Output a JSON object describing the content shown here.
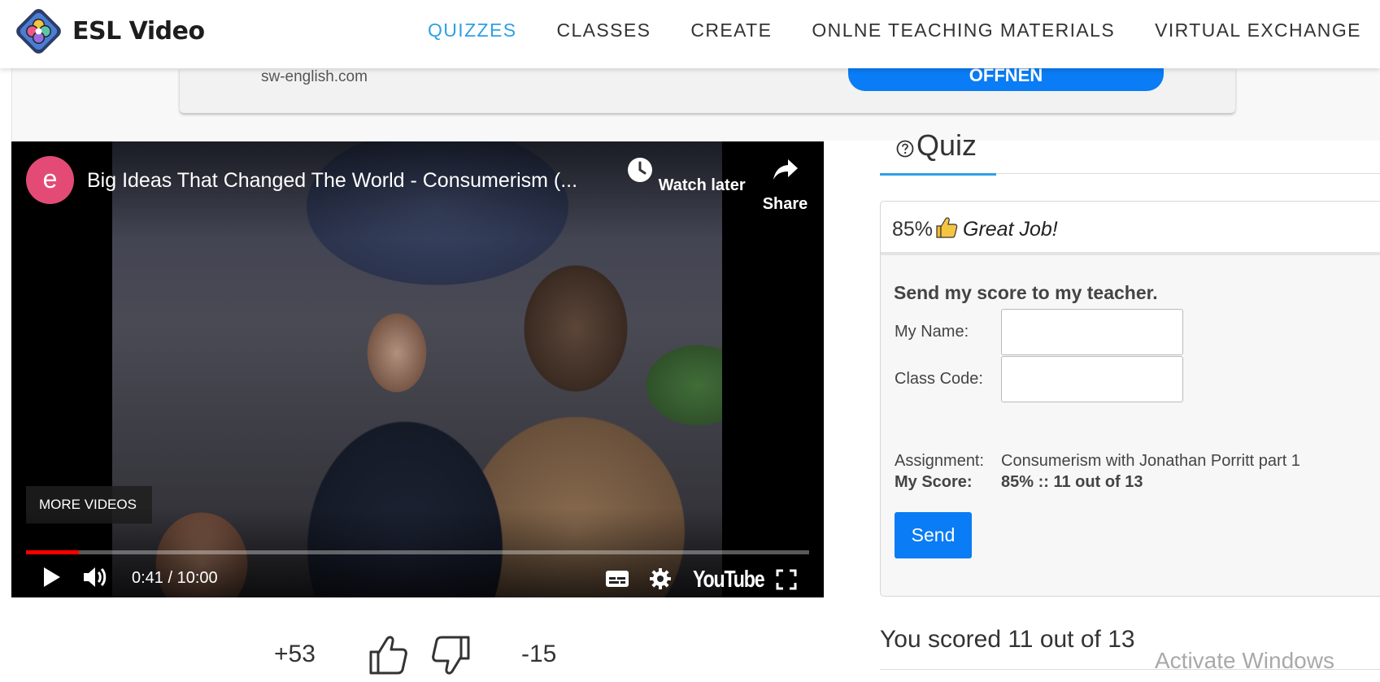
{
  "brand": {
    "name": "ESL Video"
  },
  "nav": {
    "items": [
      {
        "label": "QUIZZES",
        "active": true
      },
      {
        "label": "CLASSES",
        "active": false
      },
      {
        "label": "CREATE",
        "active": false
      },
      {
        "label": "ONLNE TEACHING MATERIALS",
        "active": false
      },
      {
        "label": "VIRTUAL EXCHANGE",
        "active": false
      }
    ],
    "active_color": "#2ea0e5"
  },
  "ad": {
    "domain": "sw-english.com",
    "button_label": "ÖFFNEN"
  },
  "video": {
    "channel_initial": "e",
    "title": "Big Ideas That Changed The World - Consumerism (...",
    "watch_later_label": "Watch later",
    "share_label": "Share",
    "more_videos_label": "MORE VIDEOS",
    "time": "0:41 / 10:00",
    "progress_fraction": 0.068,
    "platform": "YouTube"
  },
  "votes": {
    "up": "+53",
    "down": "-15"
  },
  "quiz": {
    "tab_label": "Quiz",
    "percent": "85%",
    "praise": "Great Job!",
    "send_title": "Send my score to my teacher.",
    "name_label": "My Name:",
    "name_value": "",
    "class_label": "Class Code:",
    "class_value": "",
    "assignment_label": "Assignment:",
    "assignment_value": "Consumerism with Jonathan Porritt part 1",
    "score_label": "My Score:",
    "score_value": "85% :: 11 out of 13",
    "send_label": "Send",
    "scored_text": "You scored 11 out of 13"
  },
  "watermark": {
    "text": "Activate Windows"
  },
  "colors": {
    "accent": "#2ea0e5",
    "button": "#0a7cf5",
    "channel": "#e34b76",
    "progress": "#ff0000"
  }
}
